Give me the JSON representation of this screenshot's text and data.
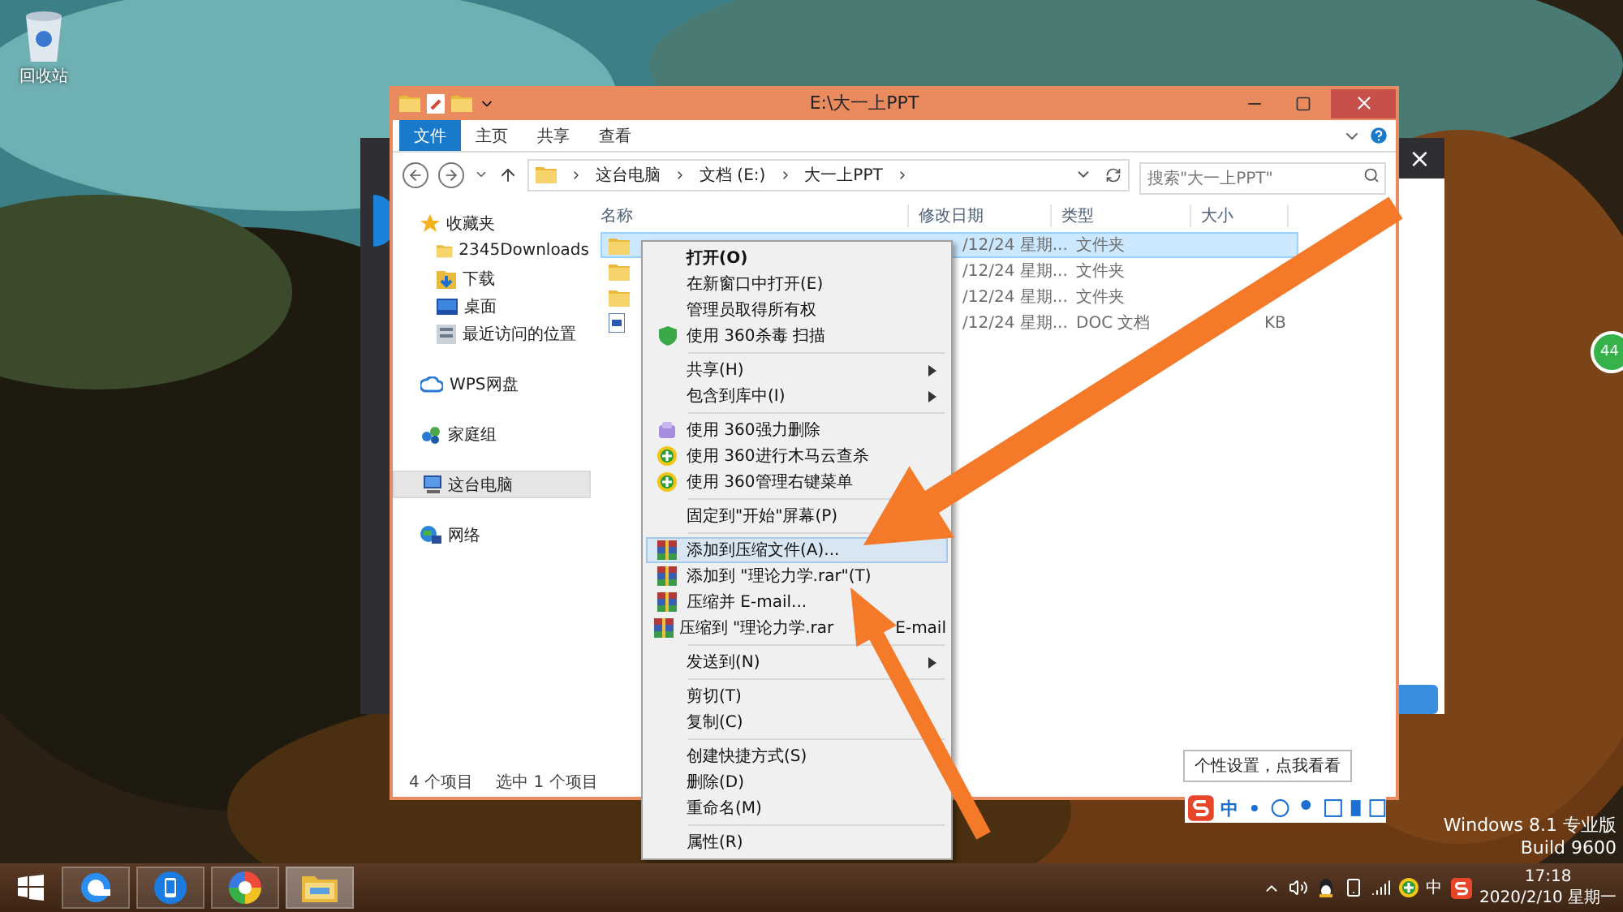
{
  "desktop": {
    "icons": [
      {
        "label": "回收站"
      }
    ],
    "os_text": [
      "Windows 8.1 专业版",
      "Build 9600"
    ],
    "badge": "44"
  },
  "back_window": {
    "close": "×"
  },
  "explorer": {
    "title": "E:\\大一上PPT",
    "ribbon_tabs": [
      {
        "label": "文件",
        "selected": true
      },
      {
        "label": "主页",
        "selected": false
      },
      {
        "label": "共享",
        "selected": false
      },
      {
        "label": "查看",
        "selected": false
      }
    ],
    "breadcrumb": [
      "这台电脑",
      "文档 (E:)",
      "大一上PPT"
    ],
    "search": {
      "placeholder": "搜索\"大一上PPT\""
    },
    "nav": [
      {
        "label": "收藏夹",
        "kind": "star",
        "selected": false,
        "children": [
          {
            "label": "2345Downloads",
            "kind": "folder",
            "selected": false
          },
          {
            "label": "下载",
            "kind": "download",
            "selected": false
          },
          {
            "label": "桌面",
            "kind": "desktop",
            "selected": false
          },
          {
            "label": "最近访问的位置",
            "kind": "recent",
            "selected": false
          }
        ]
      },
      {
        "label": "WPS网盘",
        "kind": "cloud",
        "selected": false
      },
      {
        "label": "家庭组",
        "kind": "homegroup",
        "selected": false
      },
      {
        "label": "这台电脑",
        "kind": "pc",
        "selected": true
      },
      {
        "label": "网络",
        "kind": "network",
        "selected": false
      }
    ],
    "columns": [
      "名称",
      "修改日期",
      "类型",
      "大小"
    ],
    "rows": [
      {
        "kind": "folder",
        "date": "/12/24 星期...",
        "type": "文件夹",
        "selected": true
      },
      {
        "kind": "folder",
        "date": "/12/24 星期...",
        "type": "文件夹",
        "selected": false
      },
      {
        "kind": "folder",
        "date": "/12/24 星期...",
        "type": "文件夹",
        "selected": false
      },
      {
        "kind": "doc",
        "date": "/12/24 星期...",
        "type": "DOC 文档",
        "size": "KB",
        "selected": false
      }
    ],
    "status": [
      "4 个项目",
      "选中 1 个项目"
    ]
  },
  "context_menu": [
    [
      {
        "label": "打开(O)",
        "default": true,
        "selected": false
      },
      {
        "label": "在新窗口中打开(E)",
        "selected": false
      },
      {
        "label": "管理员取得所有权",
        "selected": false
      },
      {
        "label": "使用 360杀毒 扫描",
        "kind": "shield",
        "selected": false
      }
    ],
    [
      {
        "label": "共享(H)",
        "submenu": true,
        "selected": false
      },
      {
        "label": "包含到库中(I)",
        "submenu": true,
        "selected": false
      }
    ],
    [
      {
        "label": "使用 360强力删除",
        "kind": "eraser",
        "selected": false
      },
      {
        "label": "使用 360进行木马云查杀",
        "kind": "plus",
        "selected": false
      },
      {
        "label": "使用 360管理右键菜单",
        "kind": "plus",
        "selected": false
      }
    ],
    [
      {
        "label": "固定到\"开始\"屏幕(P)",
        "selected": false
      }
    ],
    [
      {
        "label": "添加到压缩文件(A)...",
        "kind": "rar",
        "selected": true
      },
      {
        "label": "添加到 \"理论力学.rar\"(T)",
        "kind": "rar",
        "selected": false
      },
      {
        "label": "压缩并 E-mail...",
        "kind": "rar",
        "selected": false
      },
      {
        "label": "压缩到 \"理论力学.rar",
        "label_after_cover": "E-mail",
        "kind": "rar",
        "selected": false
      }
    ],
    [
      {
        "label": "发送到(N)",
        "submenu": true,
        "selected": false
      }
    ],
    [
      {
        "label": "剪切(T)",
        "selected": false
      },
      {
        "label": "复制(C)",
        "selected": false
      }
    ],
    [
      {
        "label": "创建快捷方式(S)",
        "selected": false
      },
      {
        "label": "删除(D)",
        "selected": false
      },
      {
        "label": "重命名(M)",
        "selected": false
      }
    ],
    [
      {
        "label": "属性(R)",
        "selected": false
      }
    ]
  ],
  "ime": {
    "tooltip": "个性设置，点我看看",
    "mode": "中"
  },
  "taskbar": {
    "apps": [
      {
        "kind": "browser",
        "selected": false
      },
      {
        "kind": "phone",
        "selected": false
      },
      {
        "kind": "pinwheel",
        "selected": false
      },
      {
        "kind": "explorer",
        "selected": true
      }
    ],
    "input": "中",
    "time": "17:18",
    "date": "2020/2/10 星期一"
  }
}
